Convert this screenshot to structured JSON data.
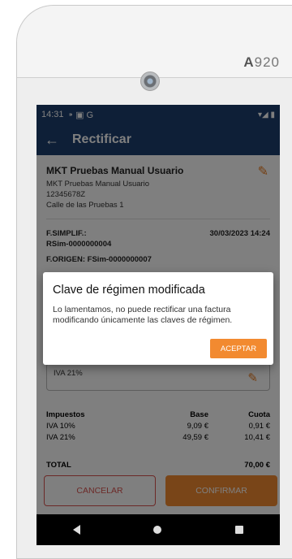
{
  "device": {
    "brand_prefix": "A",
    "brand_suffix": "920"
  },
  "statusbar": {
    "time": "14:31",
    "icons_left": "⁍ ▣ G",
    "icons_right": "▾◢ ▮"
  },
  "appbar": {
    "back_icon": "←",
    "title": "Rectificar"
  },
  "client": {
    "name": "MKT Pruebas Manual Usuario",
    "line1": "MKT Pruebas Manual Usuario",
    "line2": "12345678Z",
    "line3": "Calle de las Pruebas 1"
  },
  "invoice": {
    "label": "F.SIMPLIF.:",
    "number": "RSim-0000000004",
    "datetime": "30/03/2023 14:24",
    "origen": "F.ORIGEN: FSim-0000000007"
  },
  "iva_field": {
    "value": "IVA 21%"
  },
  "taxes": {
    "headers": [
      "Impuestos",
      "Base",
      "Cuota"
    ],
    "rows": [
      [
        "IVA 10%",
        "9,09 €",
        "0,91 €"
      ],
      [
        "IVA 21%",
        "49,59 €",
        "10,41 €"
      ]
    ]
  },
  "total": {
    "label": "TOTAL",
    "value": "70,00 €"
  },
  "buttons": {
    "cancel": "CANCELAR",
    "confirm": "CONFIRMAR"
  },
  "dialog": {
    "title": "Clave de régimen modificada",
    "message": "Lo lamentamos, no puede rectificar una factura modificando únicamente las claves de régimen.",
    "button": "ACEPTAR"
  },
  "colors": {
    "accent": "#f28a30",
    "appbar": "#1d3f6e",
    "danger": "#d9534f"
  }
}
